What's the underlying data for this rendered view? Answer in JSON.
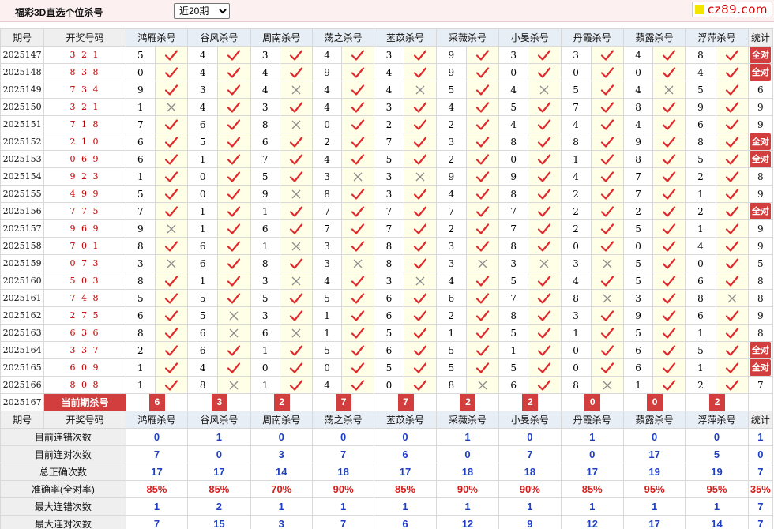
{
  "header": {
    "title": "福彩3D直选个位杀号",
    "period_selected": "近20期",
    "period_options": [
      "近20期"
    ],
    "logo_text": "cz89.com"
  },
  "columns": {
    "issue": "期号",
    "draw": "开奖号码",
    "stats": "统计",
    "killers": [
      "鸿雁杀号",
      "谷风杀号",
      "周南杀号",
      "荡之杀号",
      "苤苡杀号",
      "采薇杀号",
      "小旻杀号",
      "丹霞杀号",
      "蘋露杀号",
      "浮萍杀号"
    ]
  },
  "rows": [
    {
      "issue": "2025147",
      "draw": "3 2 1",
      "kills": [
        "5",
        "4",
        "3",
        "4",
        "3",
        "9",
        "3",
        "3",
        "4",
        "8"
      ],
      "ok": [
        1,
        1,
        1,
        1,
        1,
        1,
        1,
        1,
        1,
        1
      ],
      "stat": "全对"
    },
    {
      "issue": "2025148",
      "draw": "8 3 8",
      "kills": [
        "0",
        "4",
        "4",
        "9",
        "4",
        "9",
        "0",
        "0",
        "0",
        "4"
      ],
      "ok": [
        1,
        1,
        1,
        1,
        1,
        1,
        1,
        1,
        1,
        1
      ],
      "stat": "全对"
    },
    {
      "issue": "2025149",
      "draw": "7 3 4",
      "kills": [
        "9",
        "3",
        "4",
        "4",
        "4",
        "5",
        "4",
        "5",
        "4",
        "5"
      ],
      "ok": [
        1,
        1,
        0,
        1,
        0,
        1,
        0,
        1,
        0,
        1
      ],
      "stat": "6"
    },
    {
      "issue": "2025150",
      "draw": "3 2 1",
      "kills": [
        "1",
        "4",
        "3",
        "4",
        "3",
        "4",
        "5",
        "7",
        "8",
        "9"
      ],
      "ok": [
        0,
        1,
        1,
        1,
        1,
        1,
        1,
        1,
        1,
        1
      ],
      "stat": "9"
    },
    {
      "issue": "2025151",
      "draw": "7 1 8",
      "kills": [
        "7",
        "6",
        "8",
        "0",
        "2",
        "2",
        "4",
        "4",
        "4",
        "6"
      ],
      "ok": [
        1,
        1,
        0,
        1,
        1,
        1,
        1,
        1,
        1,
        1
      ],
      "stat": "9"
    },
    {
      "issue": "2025152",
      "draw": "2 1 0",
      "kills": [
        "6",
        "5",
        "6",
        "2",
        "7",
        "3",
        "8",
        "8",
        "9",
        "8"
      ],
      "ok": [
        1,
        1,
        1,
        1,
        1,
        1,
        1,
        1,
        1,
        1
      ],
      "stat": "全对"
    },
    {
      "issue": "2025153",
      "draw": "0 6 9",
      "kills": [
        "6",
        "1",
        "7",
        "4",
        "5",
        "2",
        "0",
        "1",
        "8",
        "5"
      ],
      "ok": [
        1,
        1,
        1,
        1,
        1,
        1,
        1,
        1,
        1,
        1
      ],
      "stat": "全对"
    },
    {
      "issue": "2025154",
      "draw": "9 2 3",
      "kills": [
        "1",
        "0",
        "5",
        "3",
        "3",
        "9",
        "9",
        "4",
        "7",
        "2"
      ],
      "ok": [
        1,
        1,
        1,
        0,
        0,
        1,
        1,
        1,
        1,
        1
      ],
      "stat": "8"
    },
    {
      "issue": "2025155",
      "draw": "4 9 9",
      "kills": [
        "5",
        "0",
        "9",
        "8",
        "3",
        "4",
        "8",
        "2",
        "7",
        "1"
      ],
      "ok": [
        1,
        1,
        0,
        1,
        1,
        1,
        1,
        1,
        1,
        1
      ],
      "stat": "9"
    },
    {
      "issue": "2025156",
      "draw": "7 7 5",
      "kills": [
        "7",
        "1",
        "1",
        "7",
        "7",
        "7",
        "7",
        "2",
        "2",
        "2"
      ],
      "ok": [
        1,
        1,
        1,
        1,
        1,
        1,
        1,
        1,
        1,
        1
      ],
      "stat": "全对"
    },
    {
      "issue": "2025157",
      "draw": "9 6 9",
      "kills": [
        "9",
        "1",
        "6",
        "7",
        "7",
        "2",
        "7",
        "2",
        "5",
        "1"
      ],
      "ok": [
        0,
        1,
        1,
        1,
        1,
        1,
        1,
        1,
        1,
        1
      ],
      "stat": "9"
    },
    {
      "issue": "2025158",
      "draw": "7 0 1",
      "kills": [
        "8",
        "6",
        "1",
        "3",
        "8",
        "3",
        "8",
        "0",
        "0",
        "4"
      ],
      "ok": [
        1,
        1,
        0,
        1,
        1,
        1,
        1,
        1,
        1,
        1
      ],
      "stat": "9"
    },
    {
      "issue": "2025159",
      "draw": "0 7 3",
      "kills": [
        "3",
        "6",
        "8",
        "3",
        "8",
        "3",
        "3",
        "3",
        "5",
        "0"
      ],
      "ok": [
        0,
        1,
        1,
        0,
        1,
        0,
        0,
        0,
        1,
        1
      ],
      "stat": "5"
    },
    {
      "issue": "2025160",
      "draw": "5 0 3",
      "kills": [
        "8",
        "1",
        "3",
        "4",
        "3",
        "4",
        "5",
        "4",
        "5",
        "6"
      ],
      "ok": [
        1,
        1,
        0,
        1,
        0,
        1,
        1,
        1,
        1,
        1
      ],
      "stat": "8"
    },
    {
      "issue": "2025161",
      "draw": "7 4 8",
      "kills": [
        "5",
        "5",
        "5",
        "5",
        "6",
        "6",
        "7",
        "8",
        "3",
        "8"
      ],
      "ok": [
        1,
        1,
        1,
        1,
        1,
        1,
        1,
        0,
        1,
        0
      ],
      "stat": "8"
    },
    {
      "issue": "2025162",
      "draw": "2 7 5",
      "kills": [
        "6",
        "5",
        "3",
        "1",
        "6",
        "2",
        "8",
        "3",
        "9",
        "6"
      ],
      "ok": [
        1,
        0,
        1,
        1,
        1,
        1,
        1,
        1,
        1,
        1
      ],
      "stat": "9"
    },
    {
      "issue": "2025163",
      "draw": "6 3 6",
      "kills": [
        "8",
        "6",
        "6",
        "1",
        "5",
        "1",
        "5",
        "1",
        "5",
        "1"
      ],
      "ok": [
        1,
        0,
        0,
        1,
        1,
        1,
        1,
        1,
        1,
        1
      ],
      "stat": "8"
    },
    {
      "issue": "2025164",
      "draw": "3 3 7",
      "kills": [
        "2",
        "6",
        "1",
        "5",
        "6",
        "5",
        "1",
        "0",
        "6",
        "5"
      ],
      "ok": [
        1,
        1,
        1,
        1,
        1,
        1,
        1,
        1,
        1,
        1
      ],
      "stat": "全对"
    },
    {
      "issue": "2025165",
      "draw": "6 0 9",
      "kills": [
        "1",
        "4",
        "0",
        "0",
        "5",
        "5",
        "5",
        "0",
        "6",
        "1"
      ],
      "ok": [
        1,
        1,
        1,
        1,
        1,
        1,
        1,
        1,
        1,
        1
      ],
      "stat": "全对"
    },
    {
      "issue": "2025166",
      "draw": "8 0 8",
      "kills": [
        "1",
        "8",
        "1",
        "4",
        "0",
        "8",
        "6",
        "8",
        "1",
        "2"
      ],
      "ok": [
        1,
        0,
        1,
        1,
        1,
        0,
        1,
        0,
        1,
        1
      ],
      "stat": "7"
    }
  ],
  "current": {
    "issue": "2025167",
    "label": "当前期杀号",
    "kills": [
      "6",
      "3",
      "2",
      "7",
      "7",
      "2",
      "2",
      "0",
      "0",
      "2"
    ]
  },
  "summary": [
    {
      "label": "目前连错次数",
      "values": [
        "0",
        "1",
        "0",
        "0",
        "0",
        "1",
        "0",
        "1",
        "0",
        "0"
      ],
      "total": "1",
      "red": false
    },
    {
      "label": "目前连对次数",
      "values": [
        "7",
        "0",
        "3",
        "7",
        "6",
        "0",
        "7",
        "0",
        "17",
        "5"
      ],
      "total": "0",
      "red": false
    },
    {
      "label": "总正确次数",
      "values": [
        "17",
        "17",
        "14",
        "18",
        "17",
        "18",
        "18",
        "17",
        "19",
        "19"
      ],
      "total": "7",
      "red": false
    },
    {
      "label": "准确率(全对率)",
      "values": [
        "85%",
        "85%",
        "70%",
        "90%",
        "85%",
        "90%",
        "90%",
        "85%",
        "95%",
        "95%"
      ],
      "total": "35%",
      "red": true
    },
    {
      "label": "最大连错次数",
      "values": [
        "1",
        "2",
        "1",
        "1",
        "1",
        "1",
        "1",
        "1",
        "1",
        "1"
      ],
      "total": "7",
      "red": false
    },
    {
      "label": "最大连对次数",
      "values": [
        "7",
        "15",
        "3",
        "7",
        "6",
        "12",
        "9",
        "12",
        "17",
        "14"
      ],
      "total": "7",
      "red": false
    }
  ],
  "colors": {
    "accent_red": "#d23d3d",
    "check_red": "#e0292c",
    "cross_gray": "#8c8c8c",
    "header_gray": "#efefef",
    "summary_blue": "#1e3fc4",
    "draw_red": "#c00000",
    "logo_yellow": "#f2e600"
  },
  "icons": {
    "correct": "check-icon",
    "wrong": "cross-icon"
  }
}
